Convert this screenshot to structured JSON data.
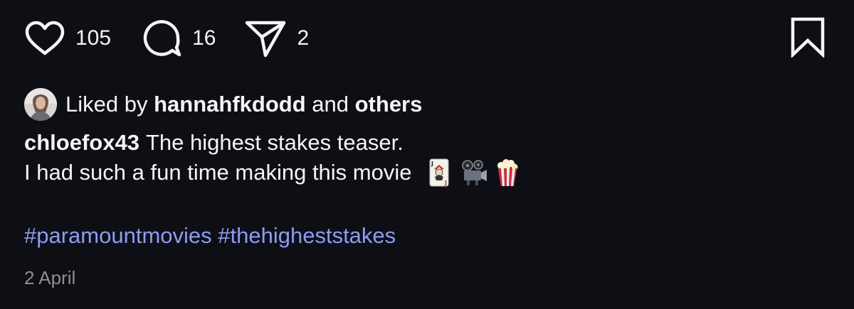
{
  "actions": {
    "like": {
      "icon": "heart-icon",
      "count": "105"
    },
    "comment": {
      "icon": "comment-icon",
      "count": "16"
    },
    "share": {
      "icon": "send-icon",
      "count": "2"
    },
    "save": {
      "icon": "bookmark-icon"
    }
  },
  "likes": {
    "prefix": "Liked by",
    "username": "hannahfkdodd",
    "conjunction": "and",
    "others": "others"
  },
  "caption": {
    "username": "chloefox43",
    "line1": "The highest stakes teaser.",
    "line2": "I had such a fun time making this movie",
    "emojis": [
      "joker-card-emoji",
      "film-projector-emoji",
      "popcorn-emoji"
    ]
  },
  "hashtags": [
    "#paramountmovies",
    "#thehigheststakes"
  ],
  "date": "2 April",
  "colors": {
    "background": "#0d0f14",
    "text": "#f5f5f7",
    "hashtag": "#8b9cf8",
    "date": "#8e8e93"
  }
}
